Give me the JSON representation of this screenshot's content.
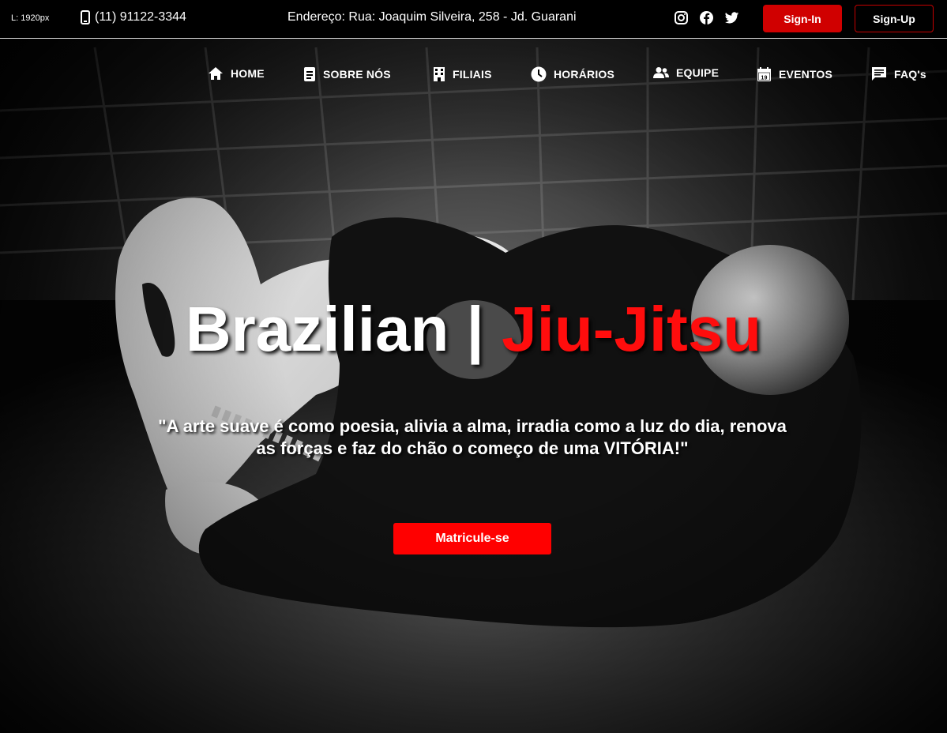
{
  "topbar": {
    "breakpoint_label": "L: 1920px",
    "phone_icon": "mobile-phone-icon",
    "phone": "(11) 91122-3344",
    "address": "Endereço: Rua: Joaquim Silveira, 258 - Jd. Guarani",
    "social_icons": [
      "instagram-icon",
      "facebook-icon",
      "twitter-icon"
    ],
    "signin_label": "Sign-In",
    "signup_label": "Sign-Up"
  },
  "nav": {
    "items": [
      {
        "label": "HOME",
        "icon": "home-icon"
      },
      {
        "label": "SOBRE NÓS",
        "icon": "document-icon"
      },
      {
        "label": "FILIAIS",
        "icon": "building-icon"
      },
      {
        "label": "HORÁRIOS",
        "icon": "clock-icon"
      },
      {
        "label": "EQUIPE",
        "icon": "users-icon"
      },
      {
        "label": "EVENTOS",
        "icon": "calendar-icon"
      },
      {
        "label": "FAQ's",
        "icon": "chat-icon"
      }
    ],
    "calendar_day": "19"
  },
  "hero": {
    "title_part1": "Brazilian",
    "title_separator": "|",
    "title_part2": "Jiu-Jitsu",
    "quote": "\"A arte suave é como poesia, alivia a alma, irradia como a luz do dia, renova as forças e faz do chão o começo de uma VITÓRIA!\"",
    "cta_label": "Matricule-se",
    "background_image": "jiu-jitsu grappling photo (black and white)"
  },
  "colors": {
    "accent_red": "#ff0000",
    "signin_red": "#d00000",
    "background": "#000000",
    "text": "#ffffff"
  }
}
